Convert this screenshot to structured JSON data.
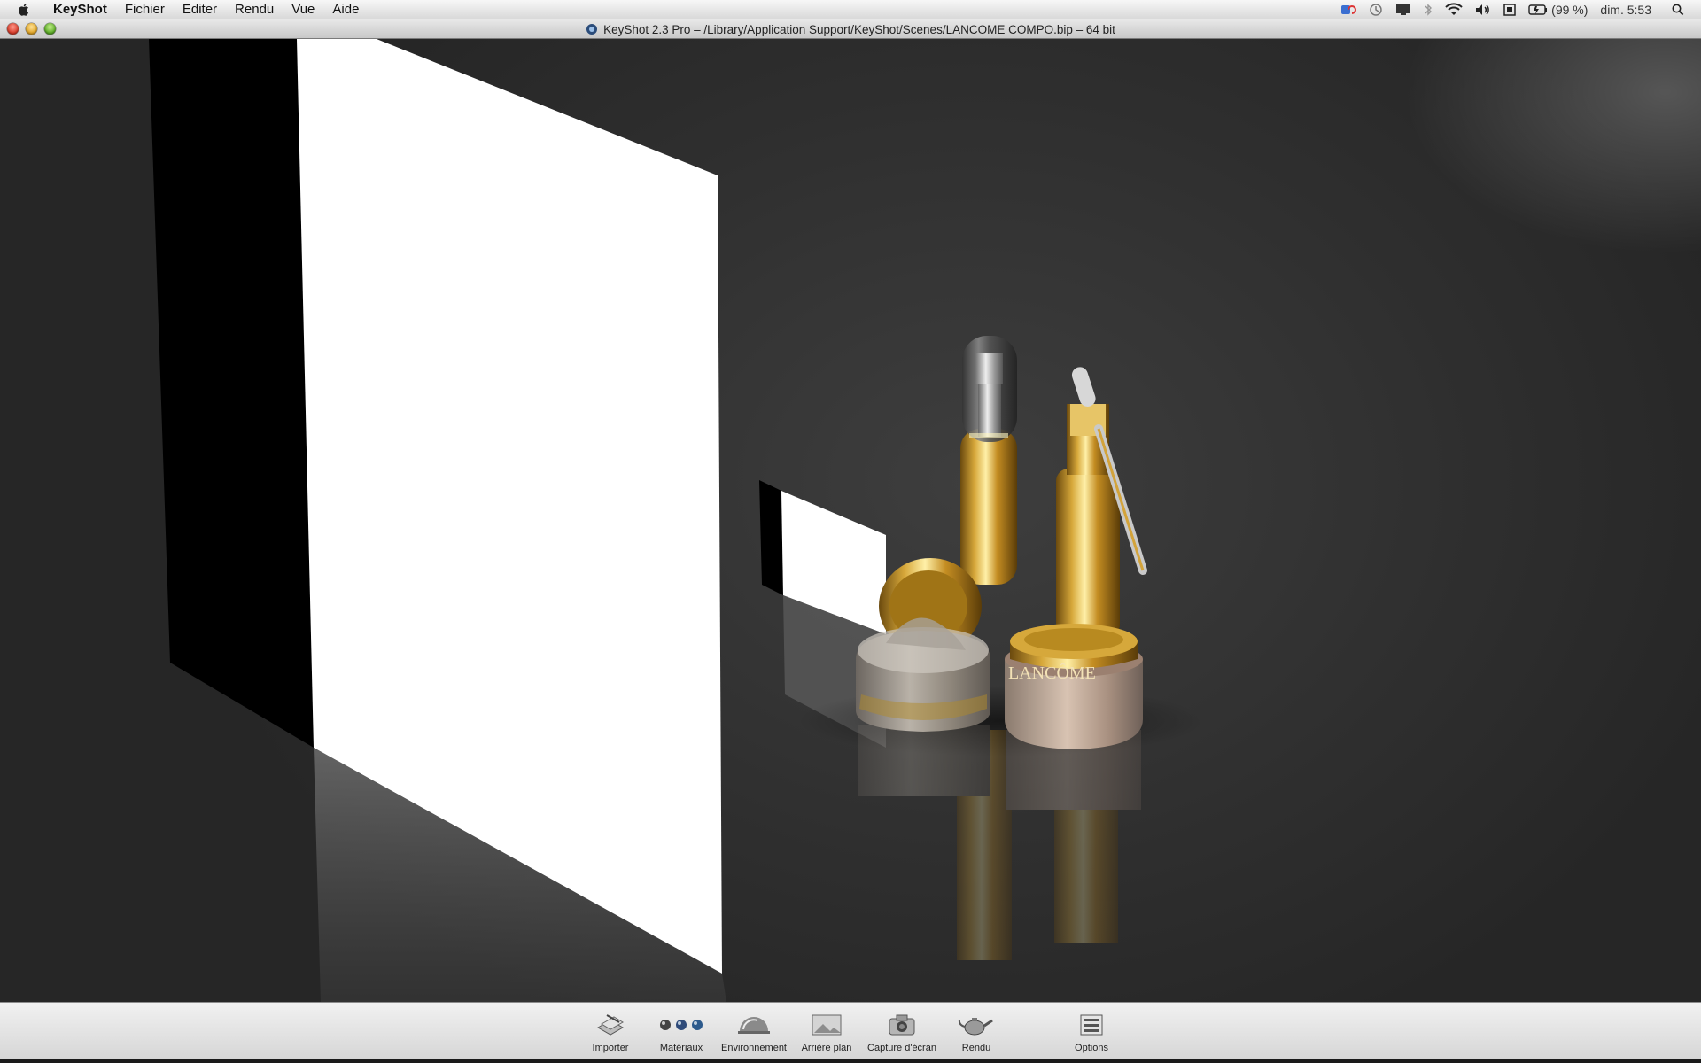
{
  "menubar": {
    "app_name": "KeyShot",
    "items": [
      "Fichier",
      "Editer",
      "Rendu",
      "Vue",
      "Aide"
    ],
    "battery": "(99 %)",
    "clock": "dim. 5:53",
    "status_icons": [
      "sync-icon",
      "time-machine-icon",
      "display-icon",
      "bluetooth-icon",
      "wifi-icon",
      "volume-icon",
      "input-icon",
      "battery-icon",
      "spotlight-icon"
    ]
  },
  "window": {
    "title": "KeyShot 2.3 Pro  – /Library/Application Support/KeyShot/Scenes/LANCOME COMPO.bip  – 64 bit"
  },
  "scene": {
    "brand_text": "LANCÔME"
  },
  "toolbar": {
    "buttons": [
      {
        "label": "Importer",
        "icon": "import-icon"
      },
      {
        "label": "Matériaux",
        "icon": "materials-icon"
      },
      {
        "label": "Environnement",
        "icon": "environment-icon"
      },
      {
        "label": "Arrière plan",
        "icon": "background-icon"
      },
      {
        "label": "Capture d'écran",
        "icon": "camera-icon"
      },
      {
        "label": "Rendu",
        "icon": "teapot-icon"
      },
      {
        "label": "Options",
        "icon": "options-icon"
      }
    ]
  },
  "colors": {
    "gold": "#c99a2a",
    "background": "#333333"
  }
}
